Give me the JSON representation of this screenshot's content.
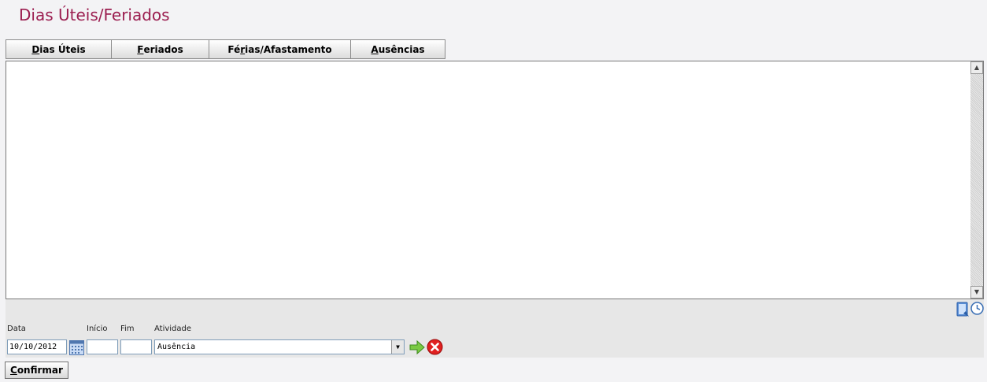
{
  "page": {
    "title": "Dias Úteis/Feriados"
  },
  "tabs": [
    {
      "label": "Dias Úteis",
      "access_key": "D",
      "rest": "ias Úteis"
    },
    {
      "label": "Feriados",
      "access_key": "F",
      "rest": "eriados"
    },
    {
      "label": "Férias/Afastamento",
      "prefix": "Fé",
      "access_key": "r",
      "rest": "ias/Afastamento"
    },
    {
      "label": "Ausências",
      "access_key": "A",
      "rest": "usências"
    }
  ],
  "form": {
    "data_label": "Data",
    "data_value": "10/10/2012",
    "inicio_label": "Início",
    "inicio_value": "",
    "fim_label": "Fim",
    "fim_value": "",
    "atividade_label": "Atividade",
    "atividade_selected": "Ausência"
  },
  "buttons": {
    "confirm_access_key": "C",
    "confirm_rest": "onfirmar",
    "confirm_label": "Confirmar"
  },
  "icons": {
    "calendar": "calendar-icon",
    "add": "green-arrow-right-icon",
    "remove": "red-x-circle-icon",
    "notes": "notes-icon",
    "clock": "clock-icon"
  },
  "colors": {
    "title": "#9b1d4f",
    "background": "#f3f3f5",
    "footer": "#e7e7e7"
  }
}
